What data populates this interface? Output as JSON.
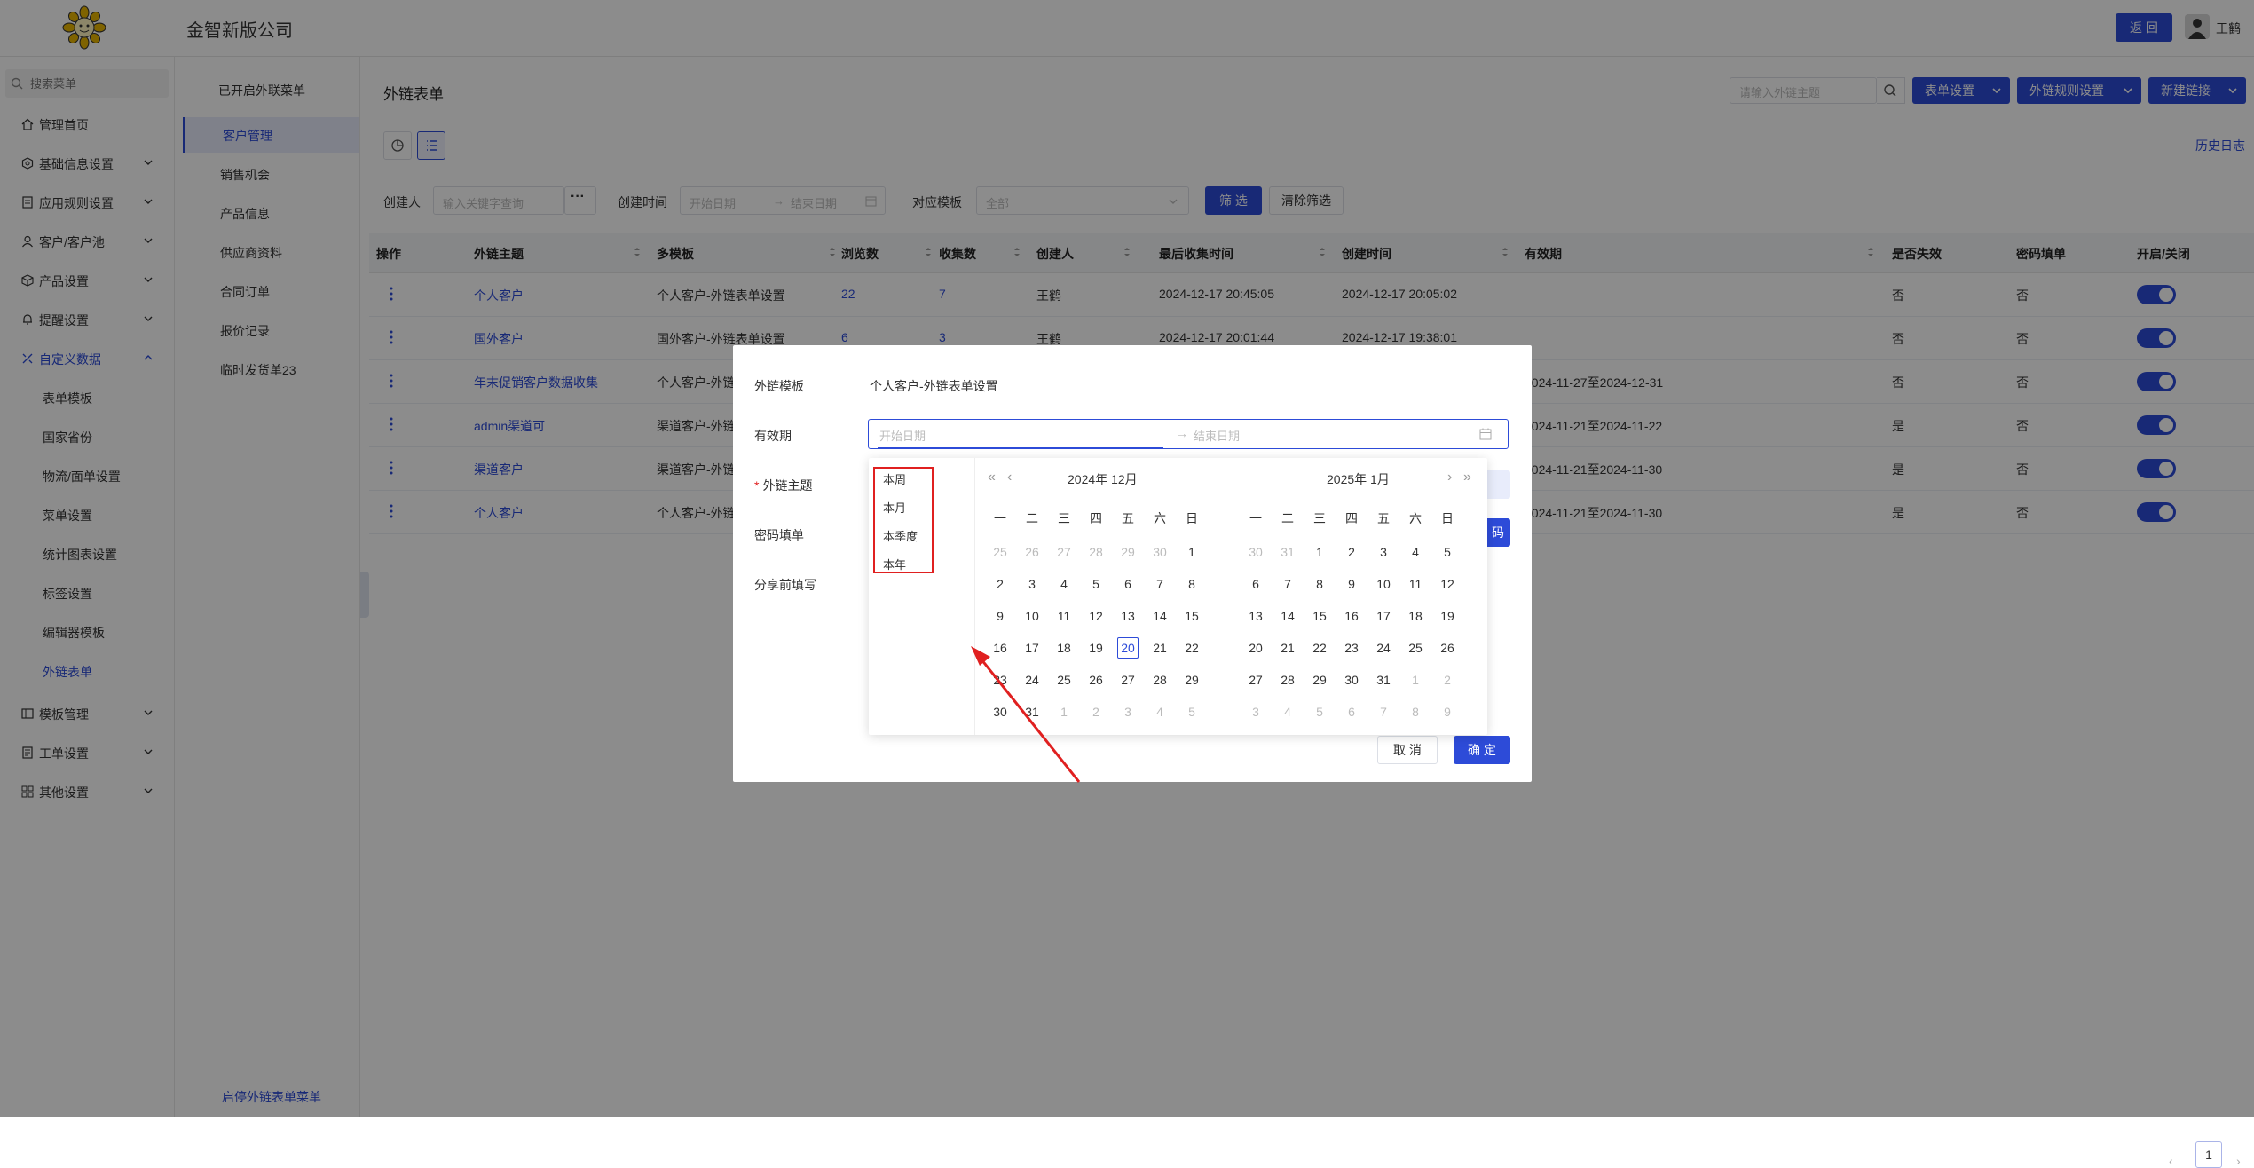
{
  "header": {
    "company": "金智新版公司",
    "back_label": "返 回",
    "user_name": "王鹤"
  },
  "sidebar": {
    "search_placeholder": "搜索菜单",
    "items": [
      {
        "label": "管理首页",
        "icon": "home-icon"
      },
      {
        "label": "基础信息设置",
        "icon": "settings-icon"
      },
      {
        "label": "应用规则设置",
        "icon": "document-icon"
      },
      {
        "label": "客户/客户池",
        "icon": "user-icon"
      },
      {
        "label": "产品设置",
        "icon": "cube-icon"
      },
      {
        "label": "提醒设置",
        "icon": "bell-icon"
      },
      {
        "label": "自定义数据",
        "icon": "custom-icon"
      }
    ],
    "sub_items": [
      "表单模板",
      "国家省份",
      "物流/面单设置",
      "菜单设置",
      "统计图表设置",
      "标签设置",
      "编辑器模板",
      "外链表单"
    ],
    "bottom_items": [
      {
        "label": "模板管理",
        "icon": "template-icon"
      },
      {
        "label": "工单设置",
        "icon": "ticket-icon"
      },
      {
        "label": "其他设置",
        "icon": "grid-icon"
      }
    ]
  },
  "col2": {
    "head": "已开启外联菜单",
    "items": [
      "客户管理",
      "销售机会",
      "产品信息",
      "供应商资料",
      "合同订单",
      "报价记录",
      "临时发货单23"
    ],
    "footer": "启停外链表单菜单"
  },
  "main": {
    "title": "外链表单",
    "search_placeholder": "请输入外链主题",
    "buttons": [
      "表单设置",
      "外链规则设置",
      "新建链接"
    ],
    "history": "历史日志",
    "filters": {
      "creator_label": "创建人",
      "creator_placeholder": "输入关键字查询",
      "created_label": "创建时间",
      "start_placeholder": "开始日期",
      "sep": "→",
      "end_placeholder": "结束日期",
      "template_label": "对应模板",
      "template_value": "全部",
      "filter_btn": "筛 选",
      "clear_btn": "清除筛选"
    },
    "columns": [
      "操作",
      "外链主题",
      "多模板",
      "浏览数",
      "收集数",
      "创建人",
      "最后收集时间",
      "创建时间",
      "有效期",
      "是否失效",
      "密码填单",
      "开启/关闭"
    ],
    "rows": [
      {
        "topic": "个人客户",
        "tpl": "个人客户-外链表单设置",
        "views": "22",
        "collects": "7",
        "creator": "王鹤",
        "last": "2024-12-17 20:45:05",
        "created": "2024-12-17 20:05:02",
        "valid": "",
        "expired": "否",
        "pwd": "否"
      },
      {
        "topic": "国外客户",
        "tpl": "国外客户-外链表单设置",
        "views": "6",
        "collects": "3",
        "creator": "王鹤",
        "last": "2024-12-17 20:01:44",
        "created": "2024-12-17 19:38:01",
        "valid": "",
        "expired": "否",
        "pwd": "否"
      },
      {
        "topic": "年末促销客户数据收集",
        "tpl": "个人客户-外链",
        "views": "",
        "collects": "",
        "creator": "",
        "last": "",
        "created": "",
        "valid": "2024-11-27至2024-12-31",
        "expired": "否",
        "pwd": "否"
      },
      {
        "topic": "admin渠道可",
        "tpl": "渠道客户-外链",
        "views": "",
        "collects": "",
        "creator": "",
        "last": "",
        "created": "",
        "valid": "2024-11-21至2024-11-22",
        "expired": "是",
        "pwd": "否"
      },
      {
        "topic": "渠道客户",
        "tpl": "渠道客户-外链",
        "views": "",
        "collects": "",
        "creator": "",
        "last": "",
        "created": "",
        "valid": "2024-11-21至2024-11-30",
        "expired": "是",
        "pwd": "否"
      },
      {
        "topic": "个人客户",
        "tpl": "个人客户-外链",
        "views": "",
        "collects": "",
        "creator": "",
        "last": "",
        "created": "",
        "valid": "2024-11-21至2024-11-30",
        "expired": "是",
        "pwd": "否"
      }
    ],
    "page": "1"
  },
  "modal": {
    "template_label": "外链模板",
    "template_value": "个人客户-外链表单设置",
    "validity_label": "有效期",
    "topic_label": "外链主题",
    "required_mark": "*",
    "password_label": "密码填单",
    "share_label": "分享前填写",
    "start_placeholder": "开始日期",
    "sep": "→",
    "end_placeholder": "结束日期",
    "right_btn": "码",
    "cancel": "取 消",
    "ok": "确 定"
  },
  "picker": {
    "presets": [
      "本周",
      "本月",
      "本季度",
      "本年"
    ],
    "left_title": "2024年  12月",
    "right_title": "2025年  1月",
    "weekdays": [
      "一",
      "二",
      "三",
      "四",
      "五",
      "六",
      "日"
    ],
    "left_days": [
      [
        "25",
        "26",
        "27",
        "28",
        "29",
        "30",
        "1"
      ],
      [
        "2",
        "3",
        "4",
        "5",
        "6",
        "7",
        "8"
      ],
      [
        "9",
        "10",
        "11",
        "12",
        "13",
        "14",
        "15"
      ],
      [
        "16",
        "17",
        "18",
        "19",
        "20",
        "21",
        "22"
      ],
      [
        "23",
        "24",
        "25",
        "26",
        "27",
        "28",
        "29"
      ],
      [
        "30",
        "31",
        "1",
        "2",
        "3",
        "4",
        "5"
      ]
    ],
    "right_days": [
      [
        "30",
        "31",
        "1",
        "2",
        "3",
        "4",
        "5"
      ],
      [
        "6",
        "7",
        "8",
        "9",
        "10",
        "11",
        "12"
      ],
      [
        "13",
        "14",
        "15",
        "16",
        "17",
        "18",
        "19"
      ],
      [
        "20",
        "21",
        "22",
        "23",
        "24",
        "25",
        "26"
      ],
      [
        "27",
        "28",
        "29",
        "30",
        "31",
        "1",
        "2"
      ],
      [
        "3",
        "4",
        "5",
        "6",
        "7",
        "8",
        "9"
      ]
    ],
    "today": "20"
  },
  "colors": {
    "accent": "#2d4bd8",
    "annotation": "#e02020"
  }
}
